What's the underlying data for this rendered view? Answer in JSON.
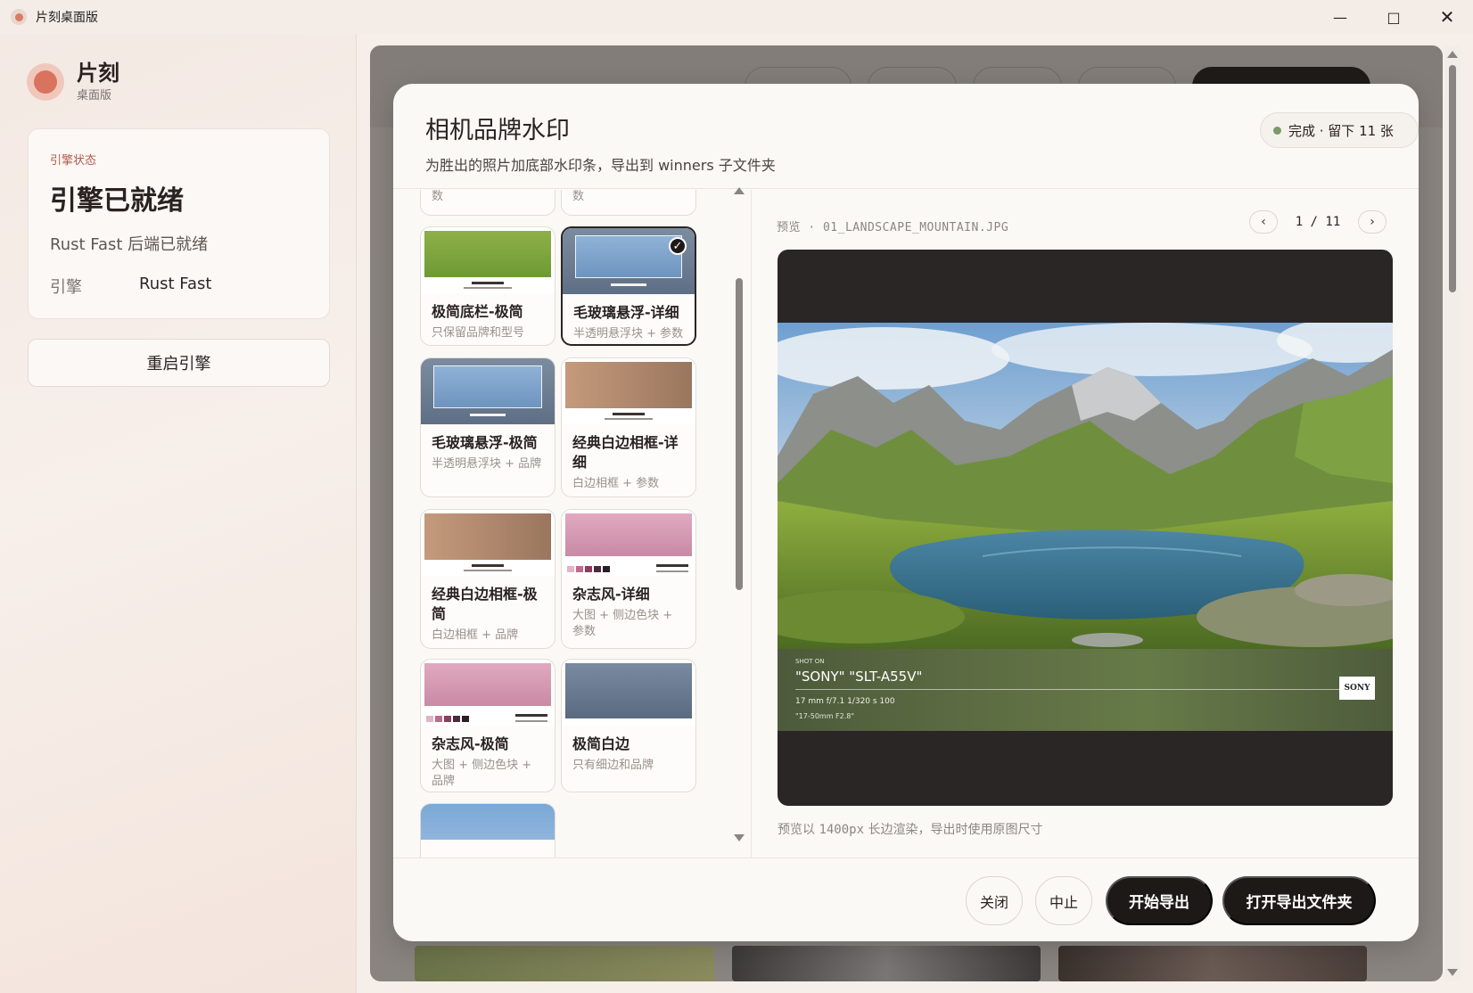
{
  "window": {
    "title": "片刻桌面版"
  },
  "sidebar": {
    "brand_name": "片刻",
    "brand_sub": "桌面版",
    "status_label": "引擎状态",
    "status_title": "引擎已就绪",
    "status_desc": "Rust Fast 后端已就绪",
    "engine_key": "引擎",
    "engine_value": "Rust Fast",
    "restart_label": "重启引擎"
  },
  "modal": {
    "title": "相机品牌水印",
    "subtitle": "为胜出的照片加底部水印条，导出到 winners 子文件夹",
    "badge": "完成 · 留下 11 张",
    "cut_desc_left": "数",
    "cut_desc_right": "数",
    "templates": [
      {
        "name": "极简底栏-极简",
        "desc": "只保留品牌和型号"
      },
      {
        "name": "毛玻璃悬浮-详细",
        "desc": "半透明悬浮块 + 参数"
      },
      {
        "name": "毛玻璃悬浮-极简",
        "desc": "半透明悬浮块 + 品牌"
      },
      {
        "name": "经典白边相框-详细",
        "desc": "白边相框 + 参数"
      },
      {
        "name": "经典白边相框-极简",
        "desc": "白边相框 + 品牌"
      },
      {
        "name": "杂志风-详细",
        "desc": "大图 + 侧边色块 + 参数"
      },
      {
        "name": "杂志风-极简",
        "desc": "大图 + 侧边色块 + 品牌"
      },
      {
        "name": "极简白边",
        "desc": "只有细边和品牌"
      }
    ],
    "preview": {
      "label": "预览 · 01_LANDSCAPE_MOUNTAIN.JPG",
      "page": "1 / 11",
      "watermark_shot": "SHOT ON",
      "watermark_title": "\"SONY\" \"SLT-A55V\"",
      "watermark_specs": "17 mm f/7.1 1/320 s 100",
      "watermark_lens": "\"17-50mm F2.8\"",
      "watermark_logo": "SONY",
      "note_pre": "预览以 ",
      "note_mono": "1400px",
      "note_post": " 长边渲染，导出时使用原图尺寸"
    },
    "buttons": {
      "close": "关闭",
      "stop": "中止",
      "start_export": "开始导出",
      "open_folder": "打开导出文件夹"
    }
  },
  "colors": {
    "accent": "#d9735e",
    "primary_button": "#1d1917",
    "status_dot": "#7a9a6e"
  }
}
